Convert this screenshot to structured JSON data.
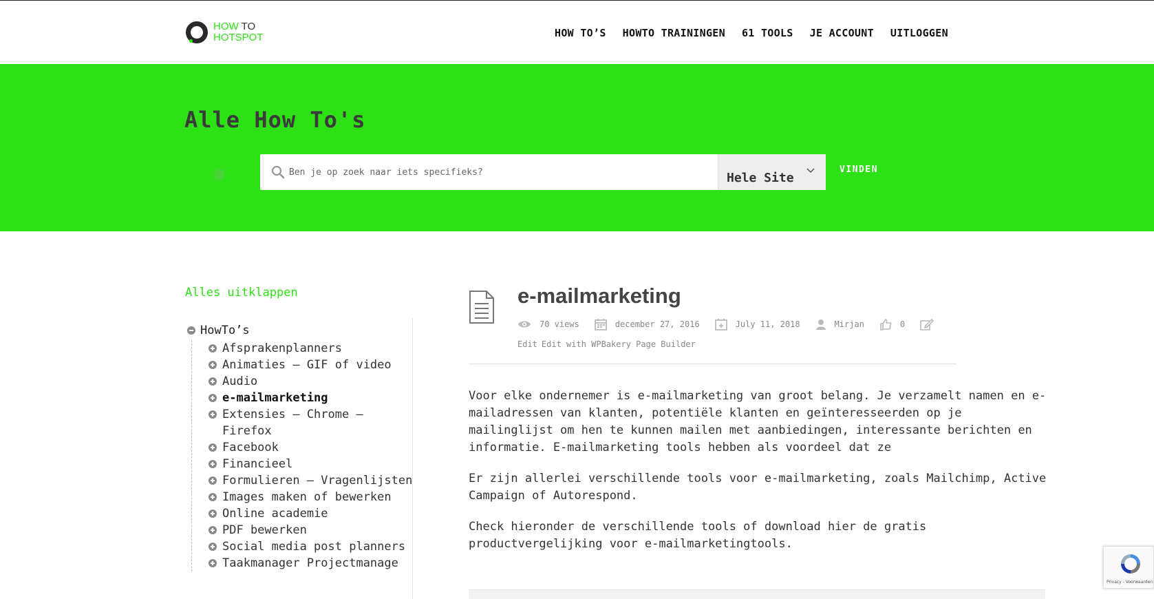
{
  "logo": {
    "line1_a": "HOW",
    "line1_b": " TO",
    "line2": "HOTSPOT"
  },
  "nav": [
    "HOW TO’S",
    "HOWTO TRAININGEN",
    "61 TOOLS",
    "JE ACCOUNT",
    "UITLOGGEN"
  ],
  "hero": {
    "title": "Alle How To's",
    "search_placeholder": "Ben je op zoek naar iets specifieks?",
    "scope_value": "Hele Site",
    "find_label": "VINDEN"
  },
  "sidebar": {
    "expand_all": "Alles uitklappen",
    "root": "HowTo’s",
    "items": [
      "Afsprakenplanners",
      "Animaties – GIF of video",
      "Audio",
      "e-mailmarketing",
      "Extensies – Chrome – Firefox",
      "Facebook",
      "Financieel",
      "Formulieren – Vragenlijsten",
      "Images maken of bewerken",
      "Online academie",
      "PDF bewerken",
      "Social media post planners",
      "Taakmanager Projectmanage"
    ],
    "active_index": 3
  },
  "article": {
    "title": "e-mailmarketing",
    "views": "70 views",
    "created": "december 27, 2016",
    "modified": "July 11, 2018",
    "author": "Mirjan",
    "likes": "0",
    "edit": "Edit",
    "edit_wpbakery": "Edit with WPBakery Page Builder",
    "paragraphs": [
      "Voor elke ondernemer is e-mailmarketing van groot belang. Je verzamelt namen en e-mailadressen van klanten, potentiële klanten en geïnteresseerden op je mailinglijst om hen te kunnen mailen met aanbiedingen, interessante berichten en informatie. E-mailmarketing tools hebben als voordeel dat ze",
      "Er zijn allerlei  verschillende tools voor e-mailmarketing, zoals Mailchimp, Active Campaign of Autorespond.",
      "Check hieronder de verschillende tools of download hier de gratis productvergelijking voor e-mailmarketingtools."
    ]
  },
  "recaptcha": {
    "text": "Privacy - Voorwaarden"
  },
  "colors": {
    "brand_green": "#2ee016",
    "text_dark": "#333333",
    "meta_grey": "#888888"
  }
}
